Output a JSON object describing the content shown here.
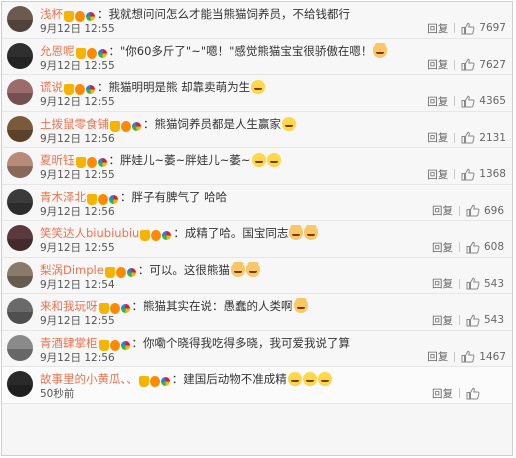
{
  "comments": [
    {
      "username": "浅杯",
      "text": "我就想问问怎么才能当熊猫饲养员，不给钱都行",
      "emojis": [],
      "time": "9月12日 12:55",
      "reply": "回复",
      "likes": "7697",
      "avatar_color": "#6d5a4f"
    },
    {
      "username": "允恩呢",
      "text": "\"你60多斤了\"~\"嗯！\"感觉熊猫宝宝很骄傲在嗯！",
      "emojis": [
        "cat"
      ],
      "time": "9月12日 12:55",
      "reply": "回复",
      "likes": "7627",
      "avatar_color": "#2f2f2f"
    },
    {
      "username": "谎说",
      "text": "熊猫明明是熊 却靠卖萌为生",
      "emojis": [
        "face"
      ],
      "time": "9月12日 12:55",
      "reply": "回复",
      "likes": "4365",
      "avatar_color": "#9c6b6b"
    },
    {
      "username": "土拨鼠零食铺",
      "text": "熊猫饲养员都是人生赢家",
      "emojis": [
        "face"
      ],
      "time": "9月12日 12:56",
      "reply": "回复",
      "likes": "2131",
      "avatar_color": "#7a5a3a"
    },
    {
      "username": "夏昕钰",
      "text": "胖娃儿~萎~胖娃儿~萎~",
      "emojis": [
        "face",
        "face"
      ],
      "time": "9月12日 12:55",
      "reply": "回复",
      "likes": "1368",
      "avatar_color": "#b88a7a"
    },
    {
      "username": "青木泽北",
      "text": "胖子有脾气了 哈哈",
      "emojis": [],
      "time": "9月12日 12:56",
      "reply": "回复",
      "likes": "696",
      "avatar_color": "#3b3b3b"
    },
    {
      "username": "笑笑达人biubiubiu",
      "text": "成精了哈。国宝同志",
      "emojis": [
        "cat",
        "cat"
      ],
      "time": "9月12日 12:55",
      "reply": "回复",
      "likes": "608",
      "avatar_color": "#5a3a3a"
    },
    {
      "username": "梨涡Dimple",
      "text": "可以。这很熊猫",
      "emojis": [
        "cat",
        "cat"
      ],
      "time": "9月12日 12:54",
      "reply": "回复",
      "likes": "543",
      "avatar_color": "#8a7a6a"
    },
    {
      "username": "来和我玩呀",
      "text": "熊猫其实在说：愚蠢的人类啊",
      "emojis": [
        "cat"
      ],
      "time": "9月12日 12:55",
      "reply": "回复",
      "likes": "543",
      "avatar_color": "#6a6a6a"
    },
    {
      "username": "青酒肆掌柜",
      "text": "你嘞个晓得我吃得多晓，我可爱我说了算",
      "emojis": [],
      "time": "9月12日 12:56",
      "reply": "回复",
      "likes": "1467",
      "avatar_color": "#8a8a8a"
    },
    {
      "username": "故事里的小黄瓜、、",
      "text": "建国后动物不准成精",
      "emojis": [
        "face",
        "face",
        "face"
      ],
      "time": "50秒前",
      "reply": "回复",
      "likes": "",
      "avatar_color": "#2a2a2a"
    }
  ],
  "colors": {
    "username": "#eb7350",
    "text": "#333333",
    "meta": "#555555"
  }
}
